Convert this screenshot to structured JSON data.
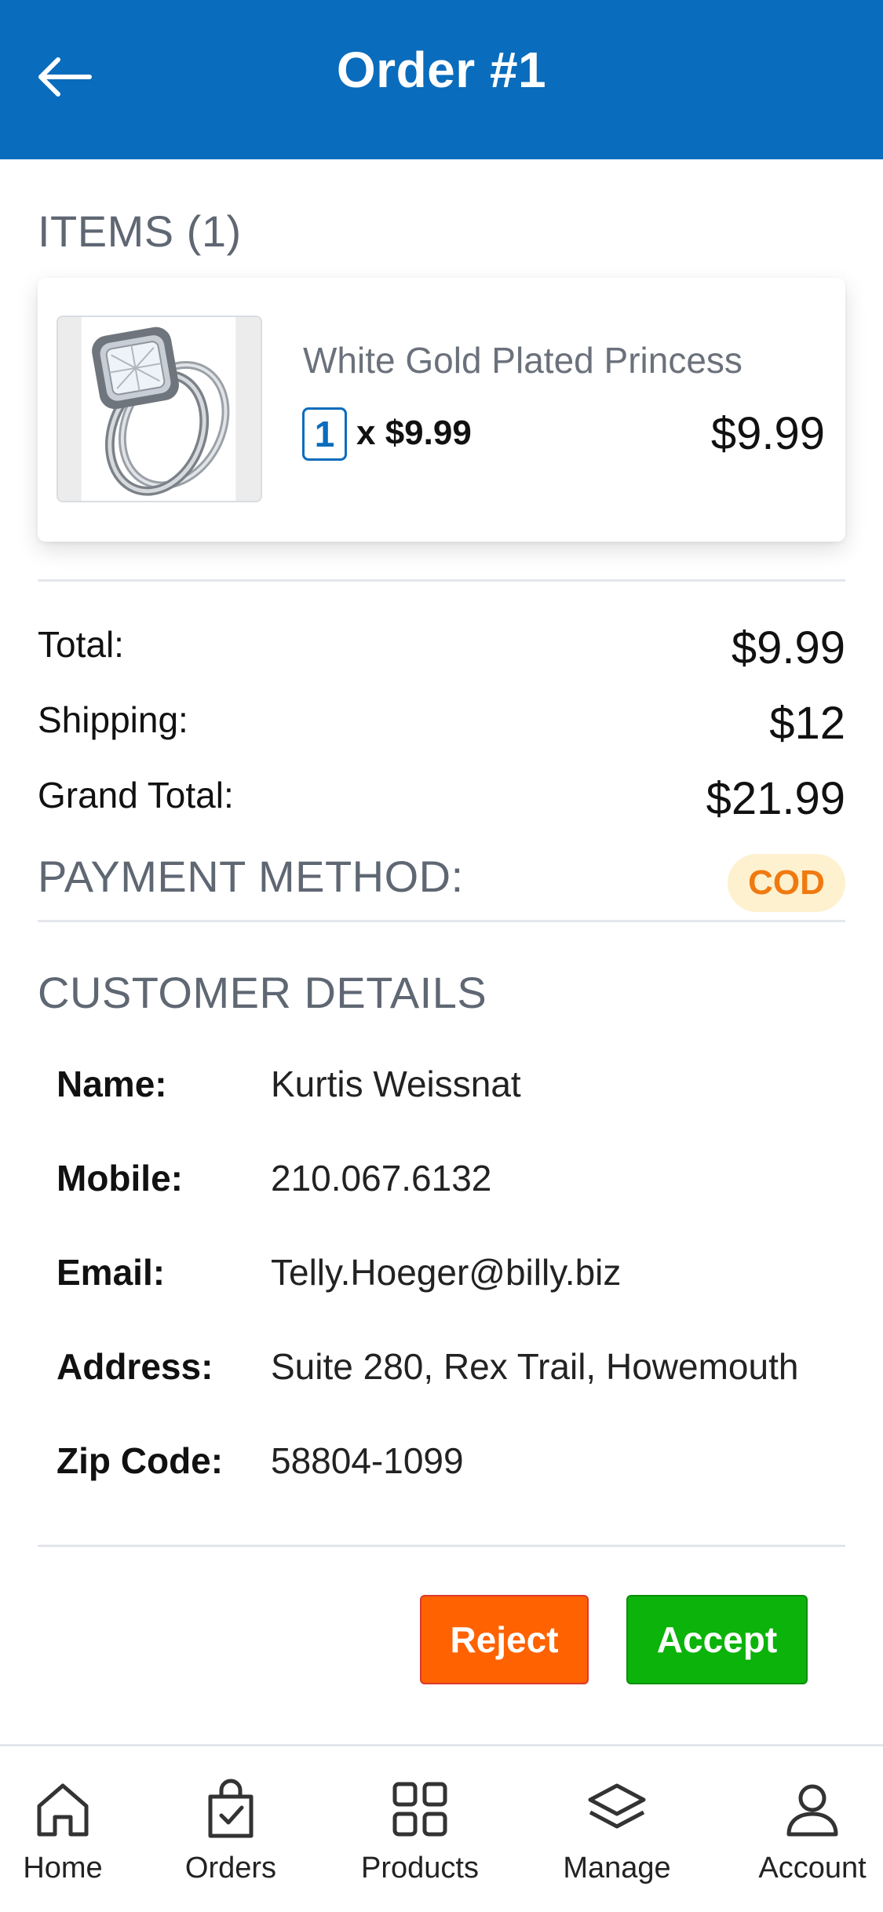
{
  "header": {
    "title": "Order #1",
    "back_icon": "arrow-left-icon",
    "background": "#0a6cbc"
  },
  "items_section": {
    "heading": "ITEMS (1)",
    "items": [
      {
        "name": "White Gold Plated Princess",
        "quantity": "1",
        "unit_price_text": "x $9.99",
        "line_total": "$9.99",
        "image": "ring-product-image"
      }
    ]
  },
  "summary": {
    "total_label": "Total:",
    "total_value": "$9.99",
    "shipping_label": "Shipping:",
    "shipping_value": "$12",
    "grand_total_label": "Grand Total:",
    "grand_total_value": "$21.99"
  },
  "payment": {
    "heading": "PAYMENT METHOD:",
    "method": "COD",
    "badge_color": "#f07a10",
    "badge_background": "#fdf1cf"
  },
  "customer": {
    "heading": "CUSTOMER DETAILS",
    "name_label": "Name:",
    "name": "Kurtis Weissnat",
    "mobile_label": "Mobile:",
    "mobile": "210.067.6132",
    "email_label": "Email:",
    "email": "Telly.Hoeger@billy.biz",
    "address_label": "Address:",
    "address": "Suite 280, Rex Trail, Howemouth",
    "zip_label": "Zip Code:",
    "zip": "58804-1099"
  },
  "actions": {
    "reject_label": "Reject",
    "reject_color": "#ff6200",
    "accept_label": "Accept",
    "accept_color": "#0bb30b"
  },
  "bottom_nav": {
    "items": [
      {
        "label": "Home",
        "icon": "home-icon"
      },
      {
        "label": "Orders",
        "icon": "shopping-bag-check-icon"
      },
      {
        "label": "Products",
        "icon": "grid-icon"
      },
      {
        "label": "Manage",
        "icon": "layers-icon"
      },
      {
        "label": "Account",
        "icon": "user-icon"
      }
    ]
  }
}
